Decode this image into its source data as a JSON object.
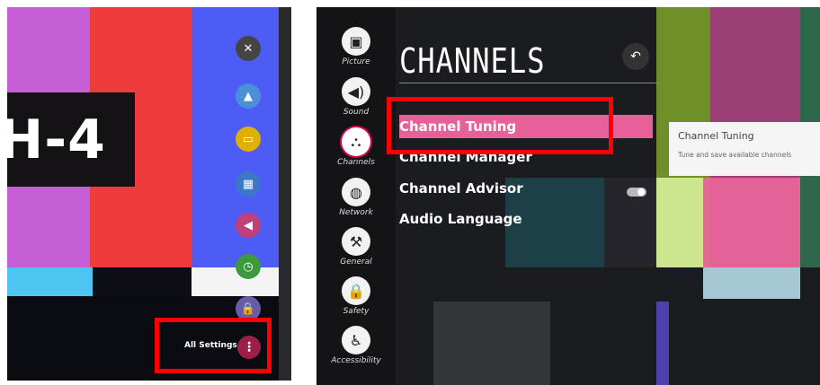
{
  "left": {
    "channel_overlay": "H-4",
    "quick_buttons": [
      {
        "name": "close-button",
        "icon": "close-icon",
        "glyph": "✕",
        "color": "#444444"
      },
      {
        "name": "picture-mode-button",
        "icon": "picture-icon",
        "glyph": "▲",
        "color": "#4a90d9"
      },
      {
        "name": "ratio-button",
        "icon": "aspect-ratio-icon",
        "glyph": "▭",
        "color": "#e0b000"
      },
      {
        "name": "grid-button",
        "icon": "grid-icon",
        "glyph": "▦",
        "color": "#3d78c8"
      },
      {
        "name": "sound-button",
        "icon": "speaker-icon",
        "glyph": "◀",
        "color": "#c0407a"
      },
      {
        "name": "timer-button",
        "icon": "clock-icon",
        "glyph": "◷",
        "color": "#3c9a3c"
      },
      {
        "name": "lock-button",
        "icon": "lock-icon",
        "glyph": "🔒",
        "color": "#6a5aa8"
      }
    ],
    "all_settings_label": "All Settings",
    "more_icon_glyph": "⋮"
  },
  "right": {
    "page_title": "CHANNELS",
    "back_glyph": "↶",
    "sidebar": [
      {
        "label": "Picture",
        "icon": "picture-icon",
        "glyph": "▣"
      },
      {
        "label": "Sound",
        "icon": "speaker-icon",
        "glyph": "◀)"
      },
      {
        "label": "Channels",
        "icon": "satellite-dish-icon",
        "glyph": "⛬",
        "active": true
      },
      {
        "label": "Network",
        "icon": "globe-icon",
        "glyph": "◍"
      },
      {
        "label": "General",
        "icon": "wrench-icon",
        "glyph": "⚒"
      },
      {
        "label": "Safety",
        "icon": "lock-icon",
        "glyph": "🔒"
      },
      {
        "label": "Accessibility",
        "icon": "accessibility-icon",
        "glyph": "♿"
      }
    ],
    "menu": [
      {
        "label": "Channel Tuning",
        "highlighted": true
      },
      {
        "label": "Channel Manager"
      },
      {
        "label": "Channel Advisor",
        "toggle": "on"
      },
      {
        "label": "Audio Language"
      }
    ],
    "tooltip": {
      "title": "Channel Tuning",
      "description": "Tune and save available channels"
    }
  },
  "colors": {
    "highlight": "#e8609a",
    "annotation_red": "#ff0000",
    "accent": "#d4004f"
  }
}
